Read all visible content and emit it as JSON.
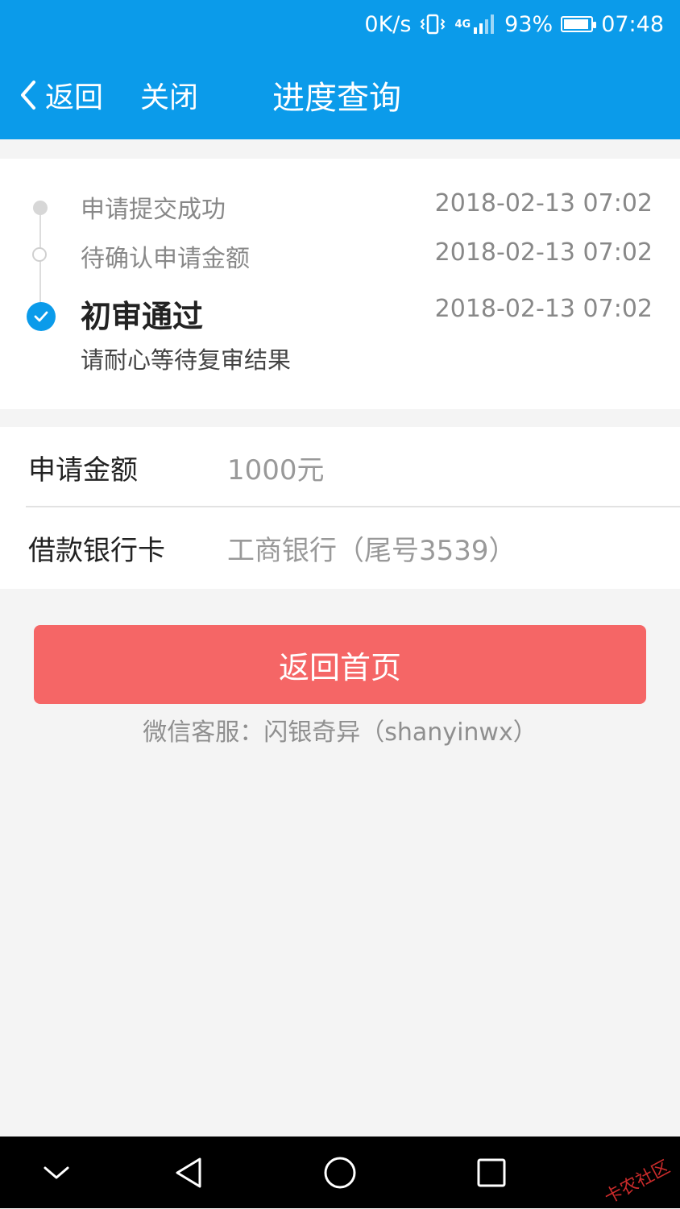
{
  "status_bar": {
    "speed": "0K/s",
    "network": "4G",
    "battery_percent": "93%",
    "battery_level": 0.93,
    "time": "07:48"
  },
  "nav": {
    "back_label": "返回",
    "close_label": "关闭",
    "title": "进度查询"
  },
  "timeline": [
    {
      "label": "申请提交成功",
      "time": "2018-02-13 07:02"
    },
    {
      "label": "待确认申请金额",
      "time": "2018-02-13 07:02"
    },
    {
      "label": "初审通过",
      "time": "2018-02-13 07:02",
      "sub": "请耐心等待复审结果"
    }
  ],
  "info": {
    "amount_label": "申请金额",
    "amount_value": "1000元",
    "card_label": "借款银行卡",
    "card_value": "工商银行（尾号3539）"
  },
  "actions": {
    "home_button": "返回首页"
  },
  "service": "微信客服：闪银奇异（shanyinwx）",
  "watermark": "卡农社区",
  "colors": {
    "primary": "#0b9bea",
    "button": "#f56666"
  }
}
